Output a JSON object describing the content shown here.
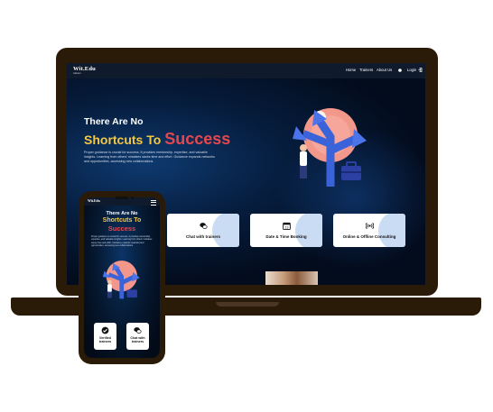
{
  "brand": {
    "logo": "Wit.Edu",
    "tagline": "trainers"
  },
  "nav": {
    "items": [
      "Home",
      "Trainers",
      "About Us"
    ],
    "login": "Login"
  },
  "hero": {
    "line1": "There Are No",
    "line2_prefix": "Shortcuts To",
    "line2_accent": "Success",
    "body": "Proper guidance is crucial for success. It provides mentorship, expertise, and valuable insights. Learning from others' mistakes saves time and effort. Guidance expands networks and opportunities, accessing new collaborations."
  },
  "features": [
    {
      "label": "Chat with trainers",
      "icon": "chat-icon"
    },
    {
      "label": "Date & Time Booking",
      "icon": "calendar-icon",
      "icon_text": "13"
    },
    {
      "label": "Online & Offline Consulting",
      "icon": "broadcast-icon"
    }
  ],
  "mobile": {
    "line1": "There Are No",
    "line2": "Shortcuts To",
    "line3": "Success",
    "body": "Proper guidance is crucial for success. It provides mentorship, expertise, and valuable insights. Learning from others' mistakes saves time and effort. Guidance expands networks and opportunities, accessing new collaborations.",
    "cards": [
      {
        "label": "Verified trainers",
        "icon": "verified-icon"
      },
      {
        "label": "Chat with trainers",
        "icon": "chat-icon"
      }
    ]
  },
  "colors": {
    "device_frame": "#2a1a08",
    "accent_red": "#e4484f",
    "accent_yellow": "#f3c844",
    "screen_bg": "#030c1d",
    "card_blob": "#c9dcf4"
  }
}
